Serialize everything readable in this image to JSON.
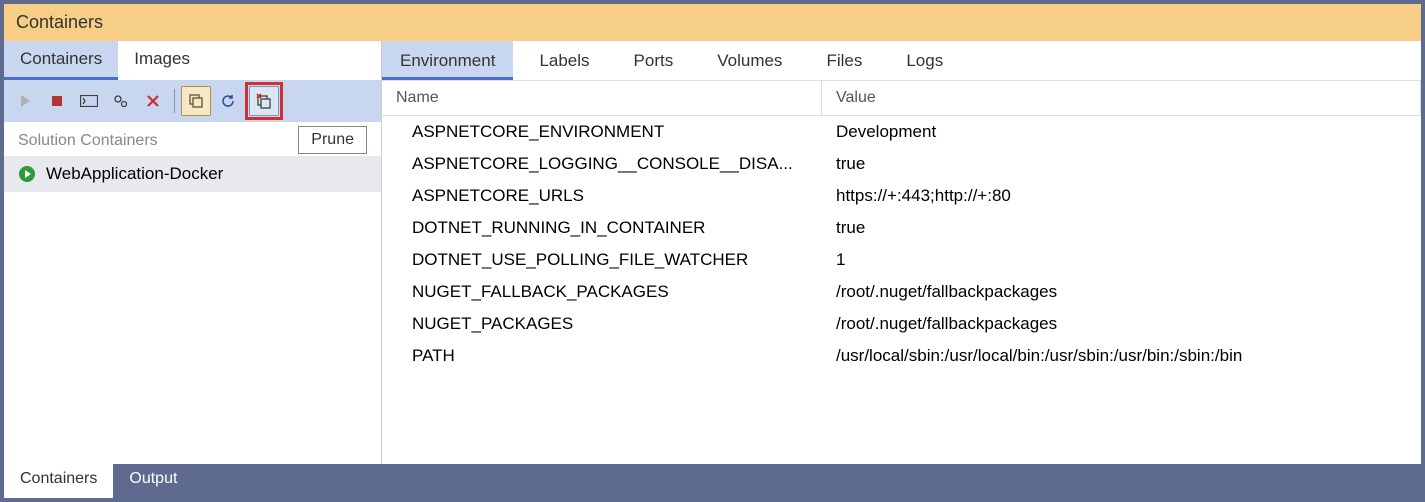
{
  "window": {
    "title": "Containers"
  },
  "left": {
    "tabs": {
      "containers": "Containers",
      "images": "Images"
    },
    "section_label": "Solution Containers",
    "tooltip": "Prune",
    "items": [
      {
        "name": "WebApplication-Docker"
      }
    ]
  },
  "right": {
    "tabs": {
      "environment": "Environment",
      "labels": "Labels",
      "ports": "Ports",
      "volumes": "Volumes",
      "files": "Files",
      "logs": "Logs"
    },
    "columns": {
      "name": "Name",
      "value": "Value"
    },
    "rows": [
      {
        "name": "ASPNETCORE_ENVIRONMENT",
        "value": "Development"
      },
      {
        "name": "ASPNETCORE_LOGGING__CONSOLE__DISA...",
        "value": "true"
      },
      {
        "name": "ASPNETCORE_URLS",
        "value": "https://+:443;http://+:80"
      },
      {
        "name": "DOTNET_RUNNING_IN_CONTAINER",
        "value": "true"
      },
      {
        "name": "DOTNET_USE_POLLING_FILE_WATCHER",
        "value": "1"
      },
      {
        "name": "NUGET_FALLBACK_PACKAGES",
        "value": "/root/.nuget/fallbackpackages"
      },
      {
        "name": "NUGET_PACKAGES",
        "value": "/root/.nuget/fallbackpackages"
      },
      {
        "name": "PATH",
        "value": "/usr/local/sbin:/usr/local/bin:/usr/sbin:/usr/bin:/sbin:/bin"
      }
    ]
  },
  "bottom": {
    "tabs": {
      "containers": "Containers",
      "output": "Output"
    }
  }
}
